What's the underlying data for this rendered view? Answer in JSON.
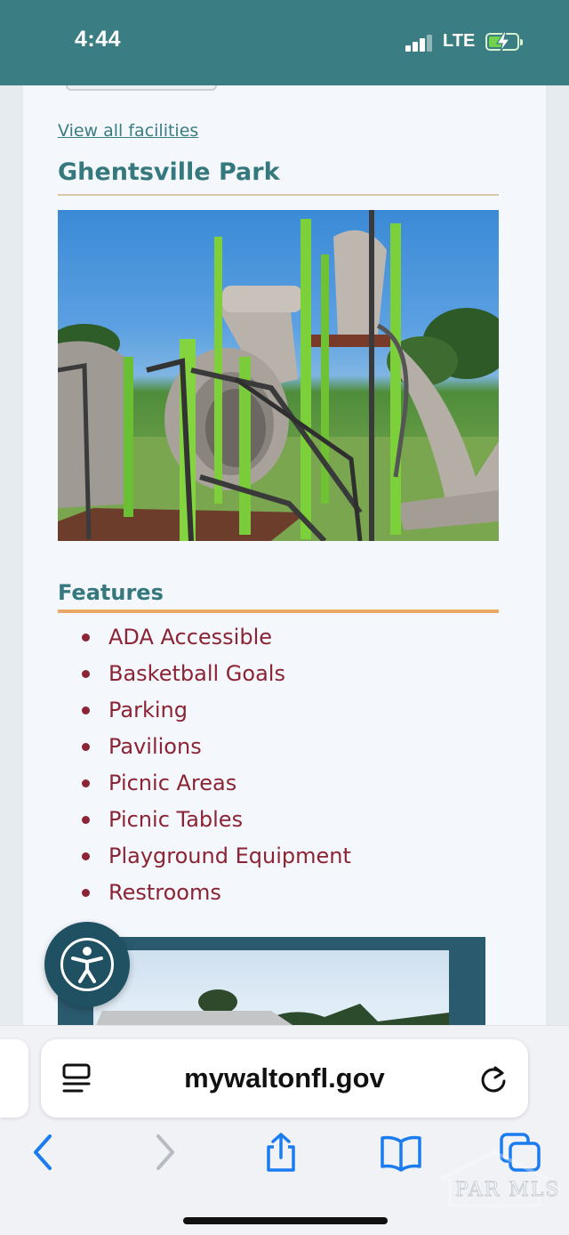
{
  "status_bar": {
    "time": "4:44",
    "network": "LTE"
  },
  "page": {
    "view_all_link": "View all facilities",
    "park_name": "Ghentsville Park",
    "features_heading": "Features",
    "features": [
      "ADA Accessible",
      "Basketball Goals",
      "Parking",
      "Pavilions",
      "Picnic Areas",
      "Picnic Tables",
      "Playground Equipment",
      "Restrooms"
    ]
  },
  "browser": {
    "url": "mywaltonfl.gov"
  },
  "watermark": {
    "text": "PAR MLS"
  },
  "colors": {
    "header": "#3a7d83",
    "heading": "#35787d",
    "feature_text": "#8b2434",
    "features_rule": "#eba766",
    "accessibility_button": "#1f5163",
    "link_blue": "#1a7cf0"
  },
  "icons": {
    "signal": "signal-bars-icon",
    "battery": "battery-charging-icon",
    "accessibility": "accessibility-person-icon",
    "reader": "reader-mode-icon",
    "reload": "reload-icon",
    "back": "chevron-left-icon",
    "forward": "chevron-right-icon",
    "share": "share-icon",
    "bookmarks": "book-icon",
    "tabs": "tabs-icon"
  }
}
